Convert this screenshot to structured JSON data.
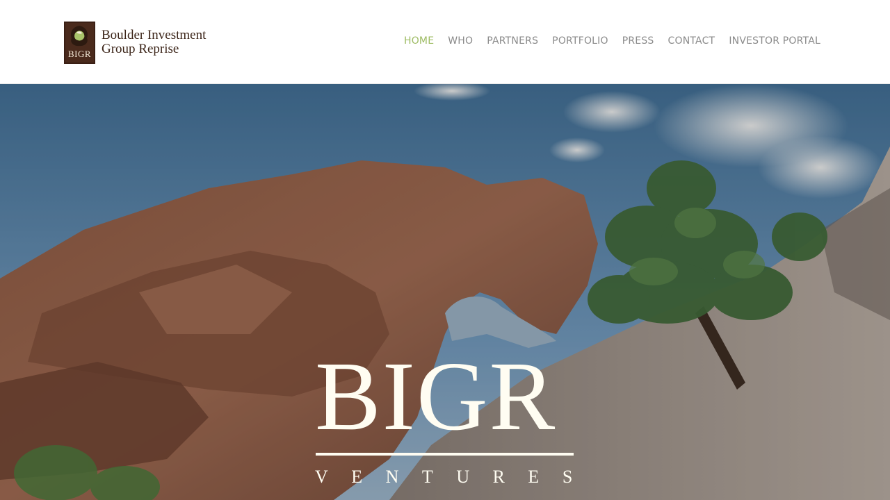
{
  "logo": {
    "mark_text": "BIGR",
    "line1": "Boulder Investment",
    "line2": "Group Reprise"
  },
  "nav": {
    "items": [
      {
        "label": "HOME",
        "active": true
      },
      {
        "label": "WHO"
      },
      {
        "label": "PARTNERS"
      },
      {
        "label": "PORTFOLIO"
      },
      {
        "label": "PRESS"
      },
      {
        "label": "CONTACT"
      },
      {
        "label": "INVESTOR PORTAL"
      }
    ]
  },
  "hero": {
    "title": "BIGR",
    "subtitle": "VENTURES"
  },
  "colors": {
    "nav_active": "#9dbb62",
    "nav_default": "#8a8a8a",
    "logo_brown": "#4a2a1c",
    "hero_text": "#fffdf2"
  }
}
